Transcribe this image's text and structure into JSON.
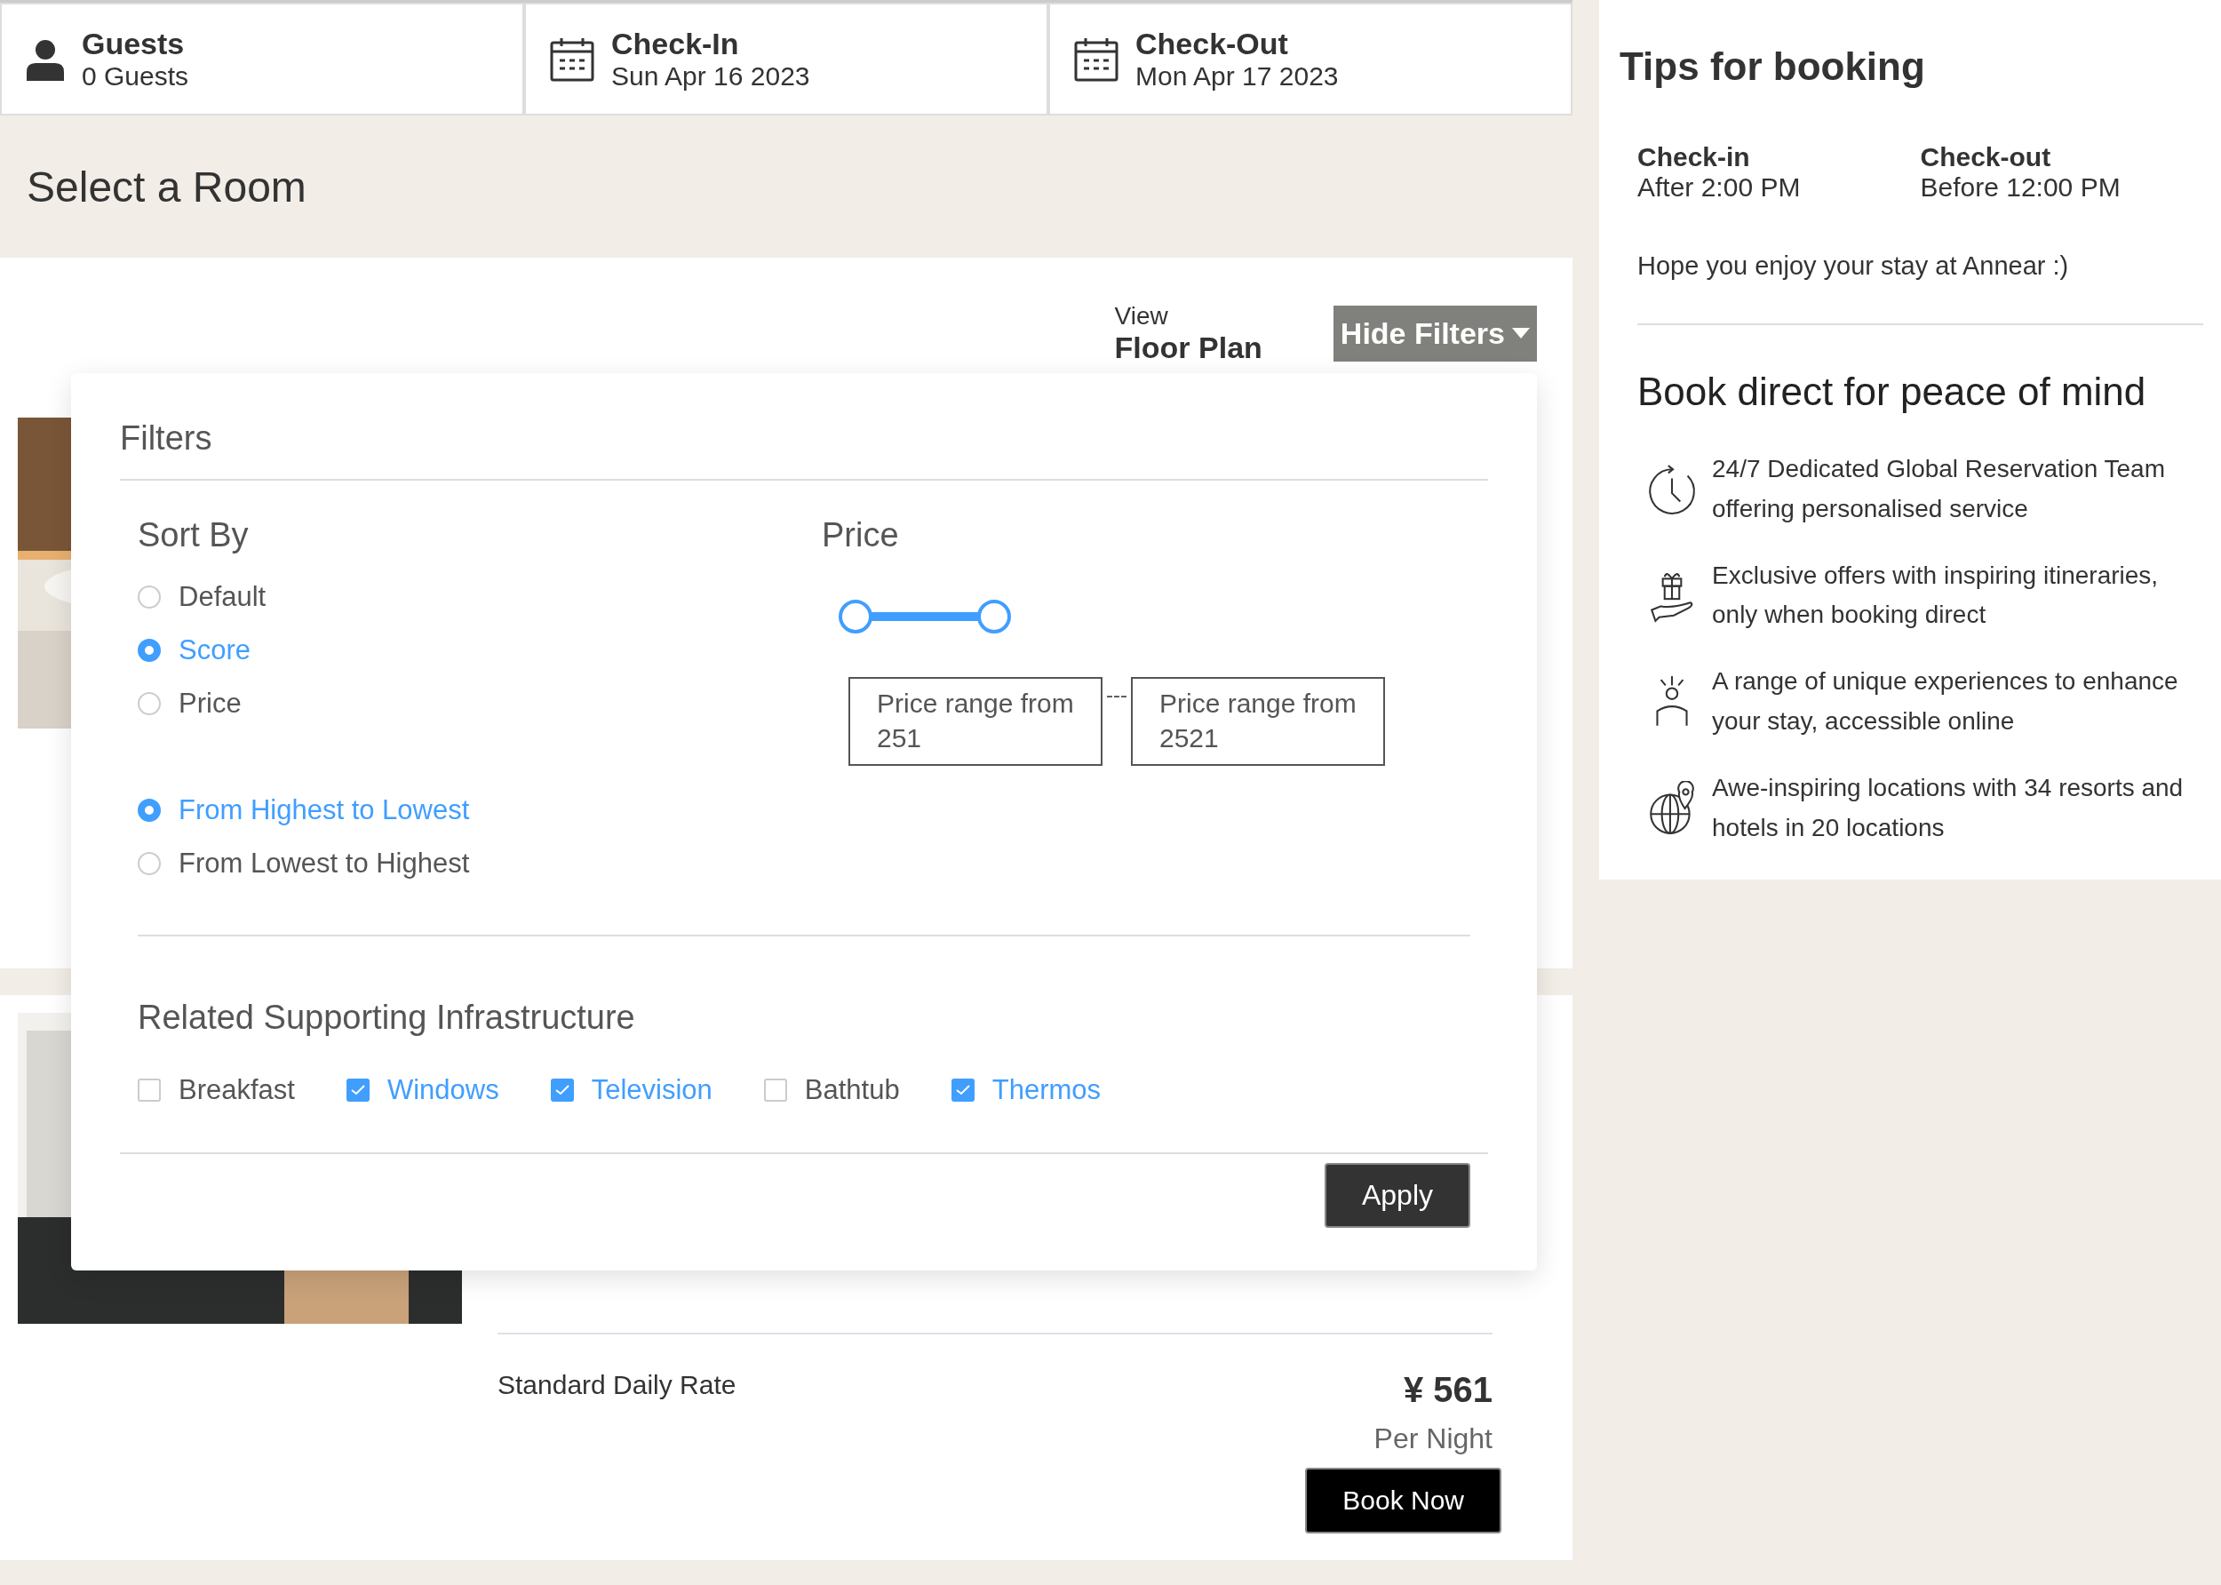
{
  "booking_bar": [
    {
      "kind": "guests",
      "label": "Guests",
      "value": "0 Guests"
    },
    {
      "kind": "date",
      "label": "Check-In",
      "value": "Sun Apr 16 2023"
    },
    {
      "kind": "date",
      "label": "Check-Out",
      "value": "Mon Apr 17 2023"
    }
  ],
  "page_title": "Select a Room",
  "toolbar": {
    "view_label": "View",
    "view_value": "Floor Plan",
    "filter_button": "Hide Filters"
  },
  "rooms": [
    {
      "image": {
        "kind": "picture"
      }
    },
    {
      "image": {
        "kind": "picture"
      },
      "rate_label": "Standard Daily Rate",
      "price": "¥ 561",
      "per": "Per Night",
      "book_button": "Book Now"
    }
  ],
  "filters": {
    "title": "Filters",
    "sort_title": "Sort By",
    "sort_options": [
      {
        "label": "Default",
        "selected": false
      },
      {
        "label": "Score",
        "selected": true
      },
      {
        "label": "Price",
        "selected": false
      }
    ],
    "order_options": [
      {
        "label": "From Highest to Lowest",
        "selected": true
      },
      {
        "label": "From Lowest to Highest",
        "selected": false
      }
    ],
    "price_title": "Price",
    "price_slider": {
      "level": 1
    },
    "price_from": "Price range from 251",
    "separator": "---",
    "price_to": "Price range from 2521",
    "amenities_title": "Related Supporting Infrastructure",
    "amenities": [
      {
        "label": "Breakfast",
        "checked": false
      },
      {
        "label": "Windows",
        "checked": true
      },
      {
        "label": "Television",
        "checked": true
      },
      {
        "label": "Bathtub",
        "checked": false
      },
      {
        "label": "Thermos",
        "checked": true
      }
    ],
    "apply_button": "Apply"
  },
  "tips": {
    "title": "Tips for booking",
    "times": [
      {
        "label": "Check-in",
        "value": "After 2:00 PM"
      },
      {
        "label": "Check-out",
        "value": "Before 12:00 PM"
      }
    ],
    "note": "Hope you enjoy your stay at Annear :)",
    "promo_title": "Book direct for peace of mind",
    "benefits": [
      {
        "kind": "clock",
        "text": "24/7 Dedicated Global Reservation Team offering personalised service"
      },
      {
        "kind": "gift",
        "text": "Exclusive offers with inspiring itineraries, only when booking direct"
      },
      {
        "kind": "vip",
        "text": "A range of unique experiences to enhance your stay, accessible online"
      },
      {
        "kind": "globe",
        "text": "Awe-inspiring locations with 34 resorts and hotels in 20 locations"
      }
    ]
  }
}
